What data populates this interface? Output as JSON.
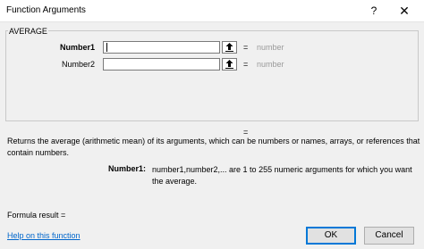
{
  "window": {
    "title": "Function Arguments",
    "help_glyph": "?",
    "close_glyph": "✕"
  },
  "function": {
    "name": "AVERAGE",
    "args": [
      {
        "label": "Number1",
        "value": "",
        "equals": "=",
        "hint": "number",
        "active": true
      },
      {
        "label": "Number2",
        "value": "",
        "equals": "=",
        "hint": "number",
        "active": false
      }
    ],
    "result_equals": "=",
    "description": "Returns the average (arithmetic mean) of its arguments, which can be numbers or names, arrays, or references that contain numbers.",
    "arg_help": {
      "name": "Number1:",
      "text": "number1,number2,... are 1 to 255 numeric arguments for which you want the average."
    }
  },
  "footer": {
    "formula_result": "Formula result =",
    "help_link": "Help on this function",
    "ok_label": "OK",
    "cancel_label": "Cancel"
  },
  "icons": {
    "collapse": "collapse-dialog-icon"
  },
  "colors": {
    "hint": "#9a9a9a",
    "link": "#0066cc",
    "ok_border": "#0078d7"
  }
}
